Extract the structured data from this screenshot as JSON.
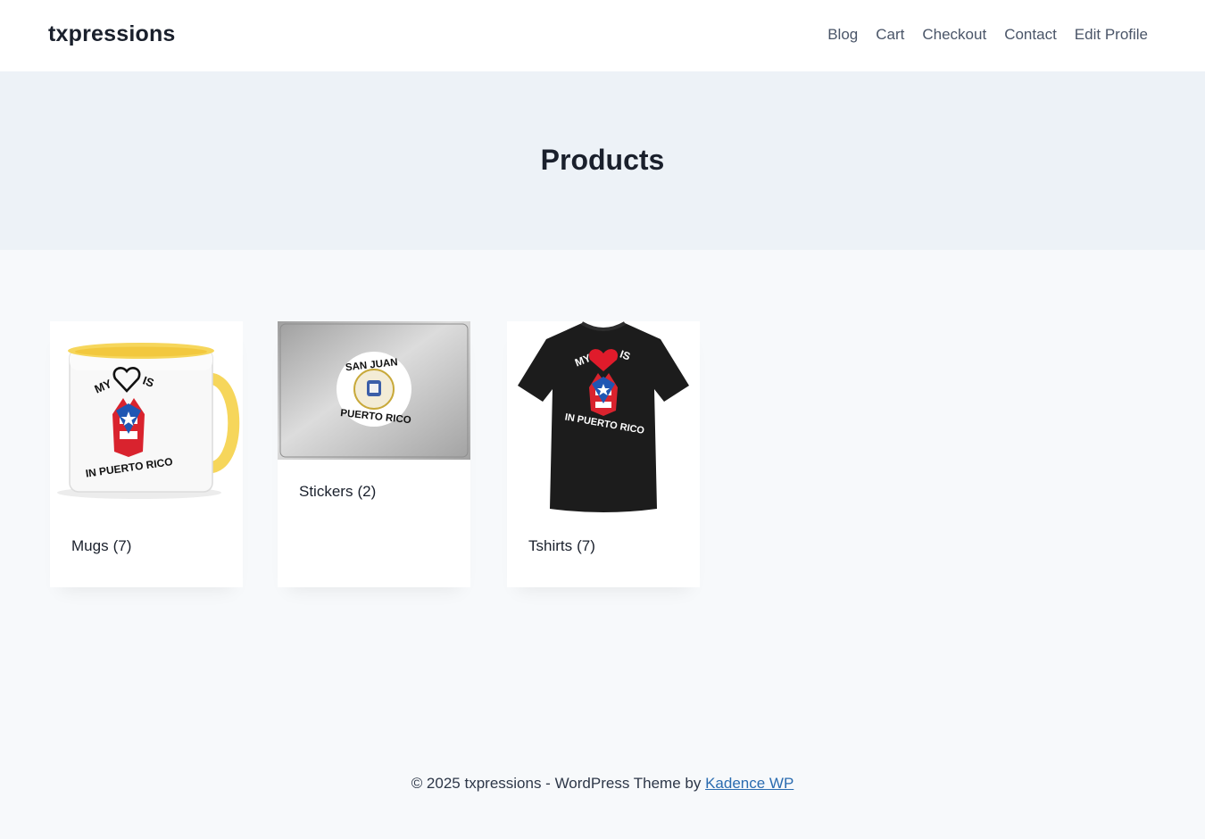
{
  "site": {
    "title": "txpressions"
  },
  "nav": {
    "items": [
      {
        "label": "Blog"
      },
      {
        "label": "Cart"
      },
      {
        "label": "Checkout"
      },
      {
        "label": "Contact"
      },
      {
        "label": "Edit Profile"
      }
    ]
  },
  "hero": {
    "title": "Products"
  },
  "products": [
    {
      "name": "Mugs",
      "count": "(7)",
      "image_text": {
        "top_left": "MY",
        "top_right": "IS",
        "bottom": "IN PUERTO RICO"
      }
    },
    {
      "name": "Stickers",
      "count": "(2)",
      "image_text": {
        "top": "SAN JUAN",
        "bottom": "PUERTO RICO"
      }
    },
    {
      "name": "Tshirts",
      "count": "(7)",
      "image_text": {
        "top_left": "MY",
        "top_right": "IS",
        "bottom": "IN PUERTO RICO"
      }
    }
  ],
  "footer": {
    "text": "© 2025 txpressions - WordPress Theme by",
    "link_label": "Kadence WP"
  },
  "colors": {
    "page_bg": "#f7f9fb",
    "hero_bg": "#edf2f7",
    "link": "#2b6cb0",
    "mug_accent": "#f6d65b",
    "flag_red": "#d9232e",
    "flag_blue": "#1f56b3",
    "heart_red": "#e01b2b"
  }
}
